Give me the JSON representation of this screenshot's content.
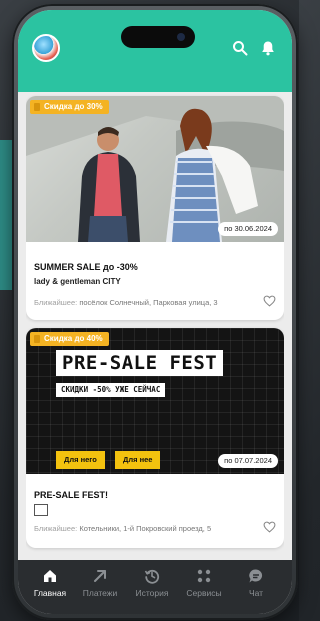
{
  "feed": {
    "cards": [
      {
        "badge": "Скидка до 30%",
        "date": "по 30.06.2024",
        "title": "SUMMER SALE до -30%",
        "brand": "lady & gentleman CITY",
        "address_label": "Ближайшее:",
        "address": "посёлок Солнечный, Парковая улица, 3"
      },
      {
        "badge": "Скидка до 40%",
        "date": "по 07.07.2024",
        "banner_title": "PRE-SALE FEST",
        "banner_subtitle": "СКИДКИ -50% УЖЕ СЕЙЧАС",
        "button_him": "Для него",
        "button_her": "Для нее",
        "title": "PRE-SALE FEST!",
        "address_label": "Ближайшее:",
        "address": "Котельники, 1-й Покровский проезд, 5"
      }
    ]
  },
  "tabbar": {
    "items": [
      {
        "label": "Главная",
        "icon": "home-icon",
        "active": true
      },
      {
        "label": "Платежи",
        "icon": "arrow-icon",
        "active": false
      },
      {
        "label": "История",
        "icon": "history-icon",
        "active": false
      },
      {
        "label": "Сервисы",
        "icon": "grid-icon",
        "active": false
      },
      {
        "label": "Чат",
        "icon": "chat-icon",
        "active": false
      }
    ]
  },
  "colors": {
    "accent": "#2bc3a1",
    "badge": "#f4b323",
    "tabbar": "#2a2d30"
  }
}
